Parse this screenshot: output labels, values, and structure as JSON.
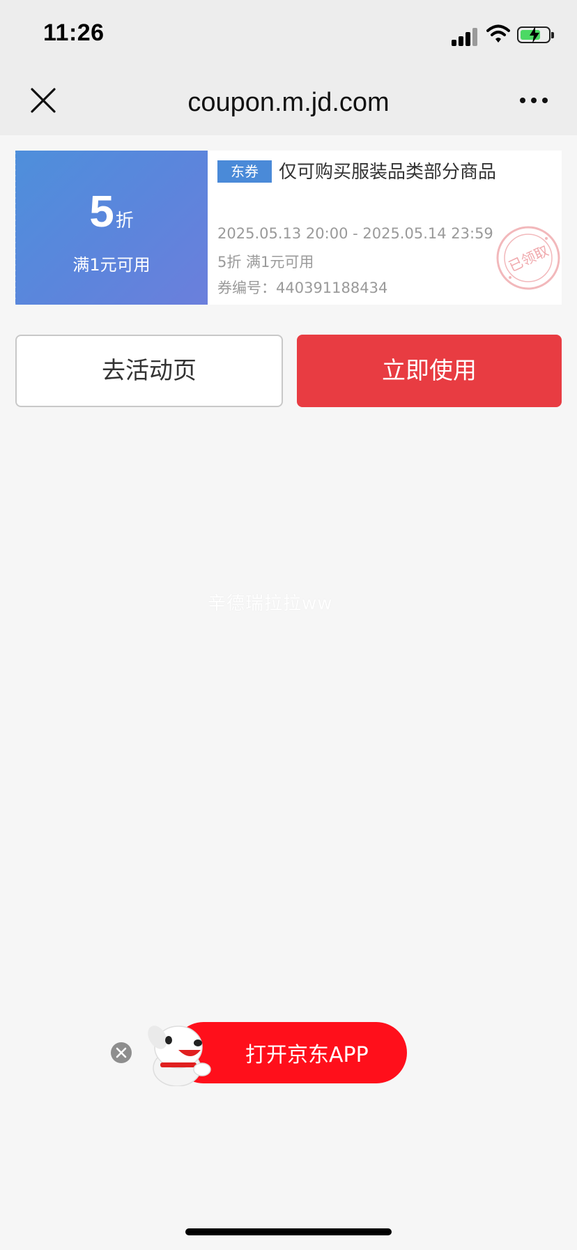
{
  "status_bar": {
    "time": "11:26"
  },
  "nav": {
    "title": "coupon.m.jd.com"
  },
  "coupon": {
    "discount_value": "5",
    "discount_unit": "折",
    "condition": "满1元可用",
    "tag": "东券",
    "title": "仅可购买服装品类部分商品",
    "validity": "2025.05.13 20:00 - 2025.05.14 23:59",
    "desc": "5折 满1元可用",
    "code_line": "券编号：440391188434",
    "stamp_text": "已领取"
  },
  "buttons": {
    "activity_page": "去活动页",
    "use_now": "立即使用"
  },
  "watermark": "辛德瑞拉拉ww",
  "app_banner": {
    "label": "打开京东APP"
  },
  "colors": {
    "primary_red": "#e83c42",
    "coupon_blue": "#5c85dc",
    "banner_red": "#ff0f1b"
  }
}
